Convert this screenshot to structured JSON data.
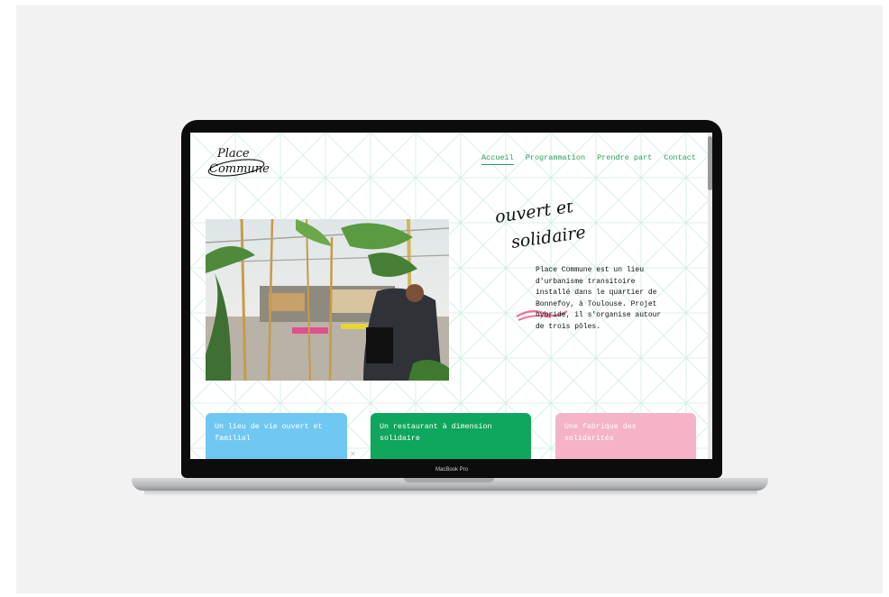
{
  "device": {
    "label": "MacBook Pro"
  },
  "site": {
    "logo_text": [
      "Place",
      "Commune"
    ],
    "nav": [
      {
        "label": "Accueil",
        "active": true
      },
      {
        "label": "Programmation",
        "active": false
      },
      {
        "label": "Prendre part",
        "active": false
      },
      {
        "label": "Contact",
        "active": false
      }
    ],
    "headline": [
      "ouvert et",
      "solidaire"
    ],
    "intro_lines": [
      "Place Commune est un lieu",
      "d'urbanisme transitoire",
      "installé dans le quartier de",
      "Bonnefoy, à Toulouse. Projet",
      "hybride, il s'organise autour",
      "de trois pôles."
    ],
    "cards": [
      {
        "title_lines": [
          "Un lieu de vie ouvert et",
          "familial"
        ],
        "color": "#70c8f2"
      },
      {
        "title_lines": [
          "Un restaurant à dimension",
          "solidaire"
        ],
        "color": "#0fa65d"
      },
      {
        "title_lines": [
          "Une fabrique des",
          "solidarités"
        ],
        "color": "#f4b3c6"
      }
    ]
  },
  "colors": {
    "accent_green": "#2aa05a",
    "grid_line": "#cfeee0",
    "backdrop": "#f2f2f2"
  },
  "icons": {
    "close": "close-icon"
  }
}
